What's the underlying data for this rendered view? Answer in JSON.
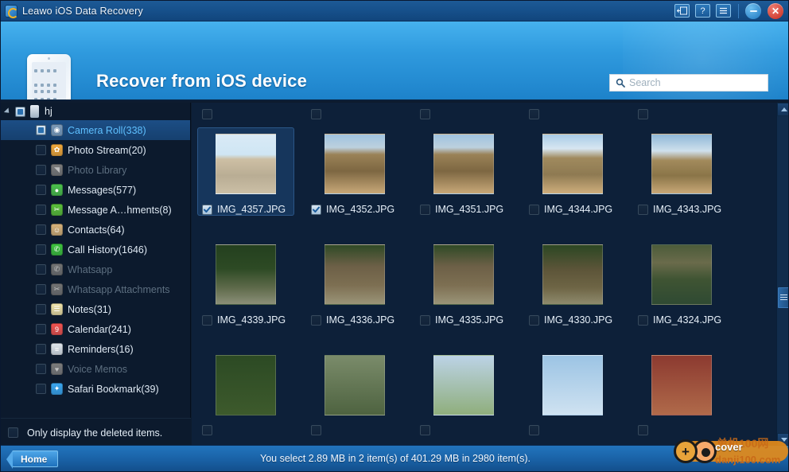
{
  "window": {
    "title": "Leawo iOS Data Recovery",
    "app_icon": "leawo-logo-icon",
    "buttons": {
      "register": "register-icon",
      "help": "?",
      "menu": "menu-icon",
      "minimize": "minimize-icon",
      "close": "✕"
    }
  },
  "header": {
    "title": "Recover from iOS device",
    "device_icon": "ipad-icon",
    "search": {
      "placeholder": "Search",
      "value": "",
      "icon": "search-icon"
    }
  },
  "sidebar": {
    "root": {
      "label": "hj",
      "icon": "iphone-icon",
      "expander": "triangle-down-icon",
      "checkbox": "partial"
    },
    "items": [
      {
        "label": "Camera Roll(338)",
        "icon": "camera-roll-icon",
        "color": "#7b98b5",
        "glyph": "◉",
        "selected": true,
        "disabled": false,
        "checked": "partial"
      },
      {
        "label": "Photo Stream(20)",
        "icon": "photo-stream-icon",
        "color": "#f2a93b",
        "glyph": "✿",
        "selected": false,
        "disabled": false,
        "checked": "off"
      },
      {
        "label": "Photo Library",
        "icon": "photo-library-icon",
        "color": "#9aa6b2",
        "glyph": "◥",
        "selected": false,
        "disabled": true,
        "checked": "off"
      },
      {
        "label": "Messages(577)",
        "icon": "messages-icon",
        "color": "#4cc14c",
        "glyph": "●",
        "selected": false,
        "disabled": false,
        "checked": "off"
      },
      {
        "label": "Message A…hments(8)",
        "icon": "message-attachments-icon",
        "color": "#5bbf3a",
        "glyph": "✂",
        "selected": false,
        "disabled": false,
        "checked": "off"
      },
      {
        "label": "Contacts(64)",
        "icon": "contacts-icon",
        "color": "#d7b27a",
        "glyph": "☺",
        "selected": false,
        "disabled": false,
        "checked": "off"
      },
      {
        "label": "Call History(1646)",
        "icon": "call-history-icon",
        "color": "#3ec23e",
        "glyph": "✆",
        "selected": false,
        "disabled": false,
        "checked": "off"
      },
      {
        "label": "Whatsapp",
        "icon": "whatsapp-icon",
        "color": "#8d9aa6",
        "glyph": "✆",
        "selected": false,
        "disabled": true,
        "checked": "off"
      },
      {
        "label": "Whatsapp Attachments",
        "icon": "whatsapp-attachments-icon",
        "color": "#8d9aa6",
        "glyph": "✂",
        "selected": false,
        "disabled": true,
        "checked": "off"
      },
      {
        "label": "Notes(31)",
        "icon": "notes-icon",
        "color": "#f0e3a8",
        "glyph": "☰",
        "selected": false,
        "disabled": false,
        "checked": "off"
      },
      {
        "label": "Calendar(241)",
        "icon": "calendar-icon",
        "color": "#ef5350",
        "glyph": "9",
        "selected": false,
        "disabled": false,
        "checked": "off"
      },
      {
        "label": "Reminders(16)",
        "icon": "reminders-icon",
        "color": "#dfe6ec",
        "glyph": "≡",
        "selected": false,
        "disabled": false,
        "checked": "off"
      },
      {
        "label": "Voice Memos",
        "icon": "voice-memos-icon",
        "color": "#9aa6b2",
        "glyph": "♥",
        "selected": false,
        "disabled": true,
        "checked": "off"
      },
      {
        "label": "Safari Bookmark(39)",
        "icon": "safari-bookmark-icon",
        "color": "#3aa6ef",
        "glyph": "✦",
        "selected": false,
        "disabled": false,
        "checked": "off"
      }
    ],
    "only_deleted": {
      "label": "Only display the deleted items.",
      "checked": false
    }
  },
  "content": {
    "rows": [
      {
        "header_checkboxes": [
          false,
          false,
          false,
          false,
          false
        ],
        "cells": [
          {
            "filename": "IMG_4357.JPG",
            "checked": true,
            "selected": true,
            "thumb": "two-people-standing-by-stone-wall-light-sky"
          },
          {
            "filename": "IMG_4352.JPG",
            "checked": true,
            "selected": false,
            "thumb": "person-standing-ruins-pyramid-background"
          },
          {
            "filename": "IMG_4351.JPG",
            "checked": false,
            "selected": false,
            "thumb": "person-standing-ruins-pyramid-background"
          },
          {
            "filename": "IMG_4344.JPG",
            "checked": false,
            "selected": false,
            "thumb": "stone-ruins-with-pyramid-and-clouds"
          },
          {
            "filename": "IMG_4343.JPG",
            "checked": false,
            "selected": false,
            "thumb": "group-of-people-at-stone-ruins"
          }
        ]
      },
      {
        "header_checkboxes": [],
        "cells": [
          {
            "filename": "IMG_4339.JPG",
            "checked": false,
            "selected": false,
            "thumb": "dark-sculpture-among-green-foliage"
          },
          {
            "filename": "IMG_4336.JPG",
            "checked": false,
            "selected": false,
            "thumb": "elephant-statue-with-tourists"
          },
          {
            "filename": "IMG_4335.JPG",
            "checked": false,
            "selected": false,
            "thumb": "elephant-statue-with-tourists"
          },
          {
            "filename": "IMG_4330.JPG",
            "checked": false,
            "selected": false,
            "thumb": "elephant-statue-in-jungle"
          },
          {
            "filename": "IMG_4324.JPG",
            "checked": false,
            "selected": false,
            "thumb": "woman-in-red-cap-by-temple-pond"
          }
        ]
      },
      {
        "header_checkboxes": [],
        "cells": [
          {
            "filename": "",
            "checked": false,
            "selected": false,
            "thumb": "green-trees-partial"
          },
          {
            "filename": "",
            "checked": false,
            "selected": false,
            "thumb": "forest-scene-partial"
          },
          {
            "filename": "",
            "checked": false,
            "selected": false,
            "thumb": "landscape-with-sky-partial"
          },
          {
            "filename": "",
            "checked": false,
            "selected": false,
            "thumb": "blue-sky-clouds-partial"
          },
          {
            "filename": "",
            "checked": false,
            "selected": false,
            "thumb": "red-building-partial"
          }
        ]
      }
    ],
    "scrollbar": {
      "up": "scroll-up-icon",
      "down": "scroll-down-icon",
      "thumb_top_pct": 54
    }
  },
  "statusbar": {
    "home_label": "Home",
    "status_text": "You select 2.89 MB in 2 item(s) of 401.29 MB in 2980 item(s).",
    "watermark": {
      "brand": "cover",
      "site": "danji100.com",
      "cn": "单机100网"
    }
  },
  "colors": {
    "titlebar": "#17518c",
    "header": "#2f9ade",
    "sidebar_bg": "#0c1a2d",
    "content_bg": "#0d2039",
    "selection": "#1c4e85",
    "accent_text": "#5fc0ff",
    "statusbar": "#1a63a8",
    "watermark": "#e38b1a"
  }
}
